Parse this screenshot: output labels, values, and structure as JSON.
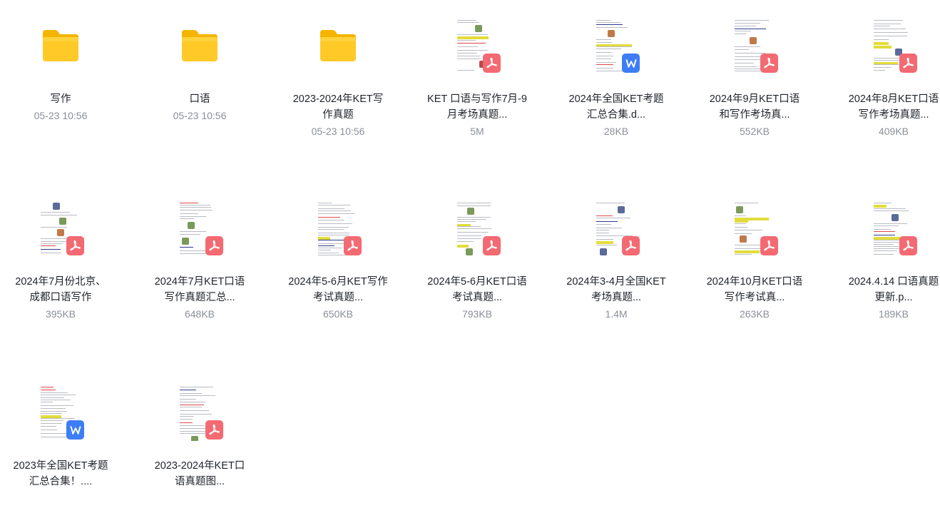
{
  "items": [
    {
      "kind": "folder",
      "name": "写作",
      "meta": "05-23 10:56",
      "icon": "folder-icon"
    },
    {
      "kind": "folder",
      "name": "口语",
      "meta": "05-23 10:56",
      "icon": "folder-icon"
    },
    {
      "kind": "folder",
      "name": "2023-2024年KET写作真题",
      "meta": "05-23 10:56",
      "icon": "folder-icon"
    },
    {
      "kind": "pdf",
      "name": "KET 口语与写作7月-9月考场真题...",
      "meta": "5M",
      "icon": "pdf-icon"
    },
    {
      "kind": "word",
      "name": "2024年全国KET考题汇总合集.d...",
      "meta": "28KB",
      "icon": "word-icon"
    },
    {
      "kind": "pdf",
      "name": "2024年9月KET口语和写作考场真...",
      "meta": "552KB",
      "icon": "pdf-icon"
    },
    {
      "kind": "pdf",
      "name": "2024年8月KET口语写作考场真题...",
      "meta": "409KB",
      "icon": "pdf-icon"
    },
    {
      "kind": "pdf",
      "name": "2024年7月份北京、成都口语写作",
      "meta": "395KB",
      "icon": "pdf-icon"
    },
    {
      "kind": "pdf",
      "name": "2024年7月KET口语写作真题汇总...",
      "meta": "648KB",
      "icon": "pdf-icon"
    },
    {
      "kind": "pdf",
      "name": "2024年5-6月KET写作考试真题...",
      "meta": "650KB",
      "icon": "pdf-icon"
    },
    {
      "kind": "pdf",
      "name": "2024年5-6月KET口语考试真题...",
      "meta": "793KB",
      "icon": "pdf-icon"
    },
    {
      "kind": "pdf",
      "name": "2024年3-4月全国KET考场真题...",
      "meta": "1.4M",
      "icon": "pdf-icon"
    },
    {
      "kind": "pdf",
      "name": "2024年10月KET口语写作考试真...",
      "meta": "263KB",
      "icon": "pdf-icon"
    },
    {
      "kind": "pdf",
      "name": "2024.4.14 口语真题更新.p...",
      "meta": "189KB",
      "icon": "pdf-icon"
    },
    {
      "kind": "word",
      "name": "2023年全国KET考题汇总合集！....",
      "meta": "",
      "icon": "word-icon"
    },
    {
      "kind": "pdf",
      "name": "2023-2024年KET口语真题图...",
      "meta": "",
      "icon": "pdf-icon"
    }
  ],
  "colors": {
    "folder": "#ffc51f",
    "pdf": "#f46a72",
    "word": "#3d7df6",
    "meta_text": "#8a8f99"
  }
}
